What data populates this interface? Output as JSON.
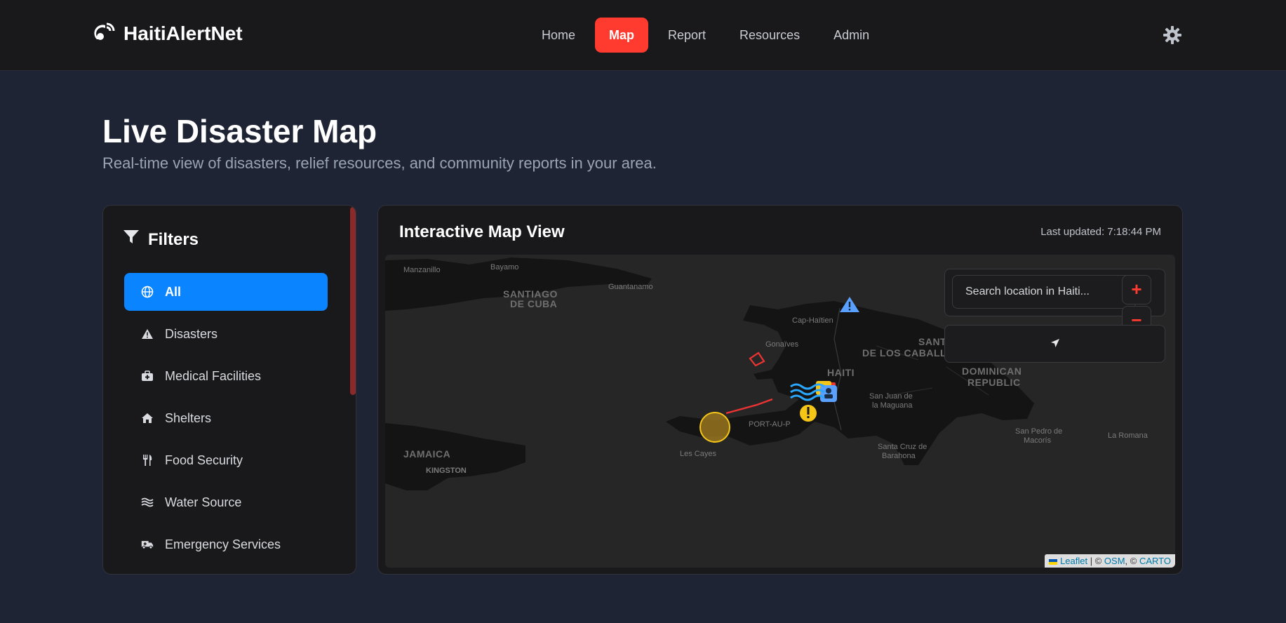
{
  "brand": {
    "name": "HaitiAlertNet"
  },
  "nav": {
    "items": [
      {
        "label": "Home",
        "active": false
      },
      {
        "label": "Map",
        "active": true
      },
      {
        "label": "Report",
        "active": false
      },
      {
        "label": "Resources",
        "active": false
      },
      {
        "label": "Admin",
        "active": false
      }
    ]
  },
  "page": {
    "title": "Live Disaster Map",
    "subtitle": "Real-time view of disasters, relief resources, and community reports in your area."
  },
  "filters": {
    "title": "Filters",
    "items": [
      {
        "label": "All",
        "icon": "globe-icon",
        "active": true
      },
      {
        "label": "Disasters",
        "icon": "warning-icon",
        "active": false
      },
      {
        "label": "Medical Facilities",
        "icon": "medical-kit-icon",
        "active": false
      },
      {
        "label": "Shelters",
        "icon": "house-icon",
        "active": false
      },
      {
        "label": "Food Security",
        "icon": "utensils-icon",
        "active": false
      },
      {
        "label": "Water Source",
        "icon": "water-icon",
        "active": false
      },
      {
        "label": "Emergency Services",
        "icon": "ambulance-icon",
        "active": false
      }
    ]
  },
  "map": {
    "title": "Interactive Map View",
    "last_updated": "Last updated: 7:18:44 PM",
    "search_placeholder": "Search location in Haiti...",
    "zoom_in": "+",
    "zoom_out": "−",
    "attribution": {
      "leaflet": "Leaflet",
      "sep": " | © ",
      "osm": "OSM",
      "comma": ", © ",
      "carto": "CARTO"
    },
    "places": {
      "manzanillo": "Manzanillo",
      "bayamo": "Bayamo",
      "santiago": "SANTIAGO",
      "de_cuba": "DE CUBA",
      "guantanamo": "Guantanamo",
      "cap_haitien": "Cap-Haïtien",
      "gonaives": "Gonaïves",
      "haiti": "HAITI",
      "santi": "SANTI",
      "de_los_caballe": "DE LOS CABALLE",
      "dominican": "DOMINICAN",
      "republic": "REPUBLIC",
      "san_juan": "San Juan de",
      "la_maguana": "la Maguana",
      "port_au_prince": "PORT-AU-P",
      "jamaica": "JAMAICA",
      "kingston": "KINGSTON",
      "les_cayes": "Les Cayes",
      "santa_cruz": "Santa Cruz de",
      "barahona": "Barahona",
      "san_pedro": "San Pedro de",
      "macoris": "Macorís",
      "la_romana": "La Romana"
    }
  },
  "colors": {
    "accent_red": "#ff3b30",
    "accent_blue": "#0b84ff",
    "warning_yellow": "#f5c518"
  }
}
